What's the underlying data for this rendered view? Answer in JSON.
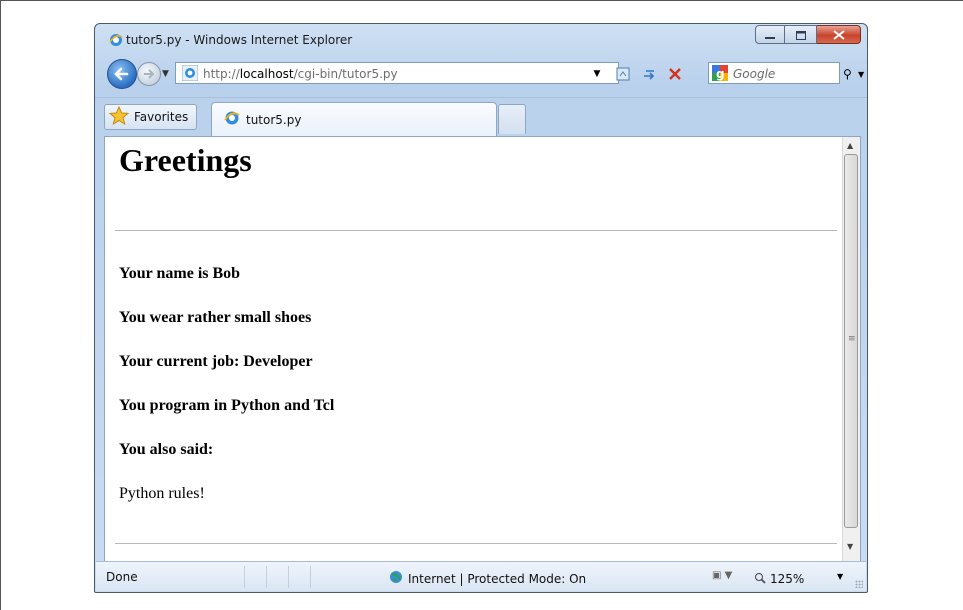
{
  "window": {
    "title": "tutor5.py - Windows Internet Explorer",
    "caption_buttons": [
      "minimize-icon",
      "maximize-icon",
      "close-icon"
    ]
  },
  "navbar": {
    "address_prefix": "http://",
    "address_host": "localhost",
    "address_path": "/cgi-bin/tutor5.py",
    "search_placeholder": "Google"
  },
  "tabs": {
    "favorites_label": "Favorites",
    "active_tab_label": "tutor5.py"
  },
  "page": {
    "heading": "Greetings",
    "lines": [
      "Your name is Bob",
      "You wear rather small shoes",
      "Your current job: Developer",
      "You program in Python and Tcl",
      "You also said:"
    ],
    "comment": "Python rules!"
  },
  "status": {
    "text": "Done",
    "zone": "Internet | Protected Mode: On",
    "zoom": "125%"
  },
  "colors": {
    "window_frame": "#b9d1ec",
    "close_button": "#c8432c"
  }
}
